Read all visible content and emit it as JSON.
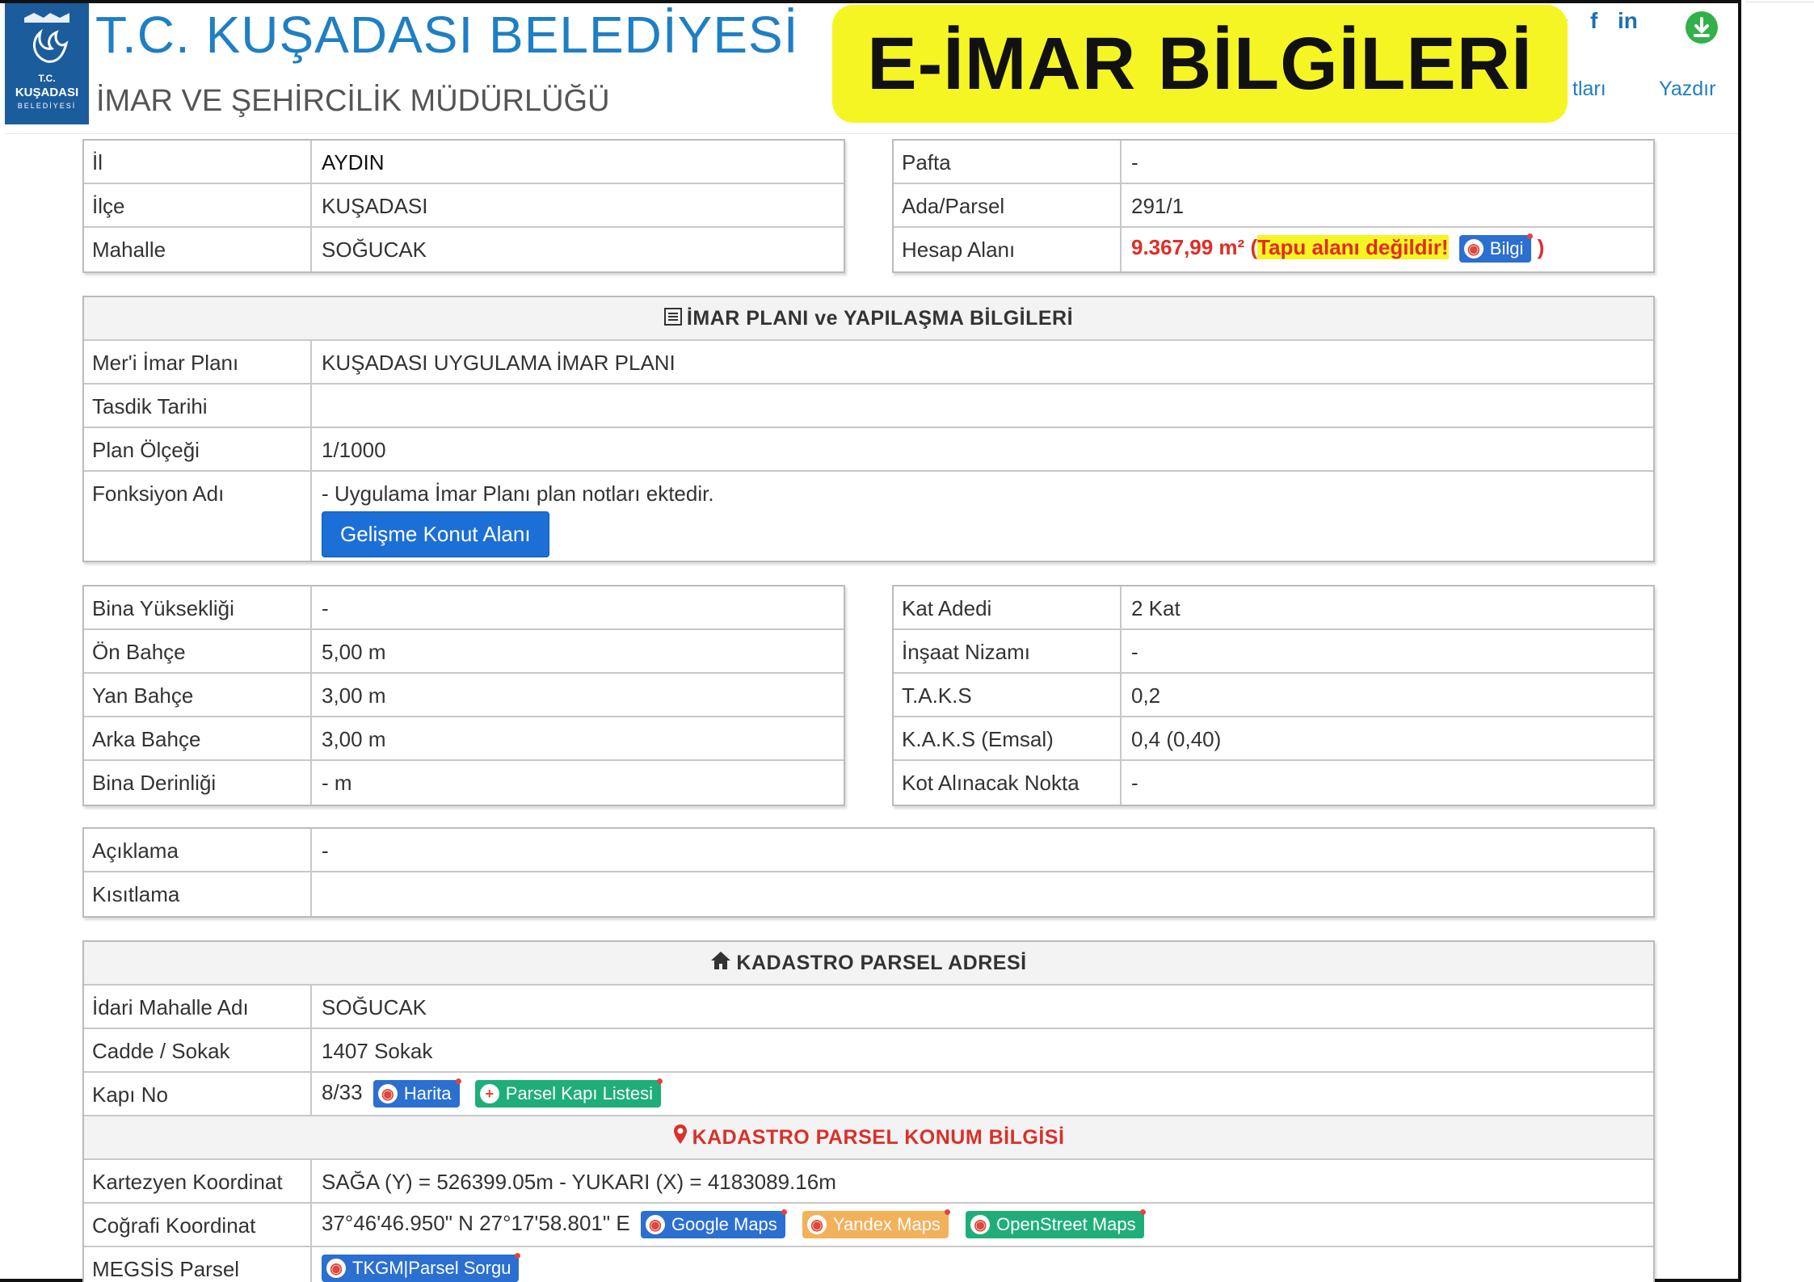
{
  "header": {
    "title": "T.C. KUŞADASI BELEDİYESİ",
    "subtitle": "İMAR VE ŞEHİRCİLİK MÜDÜRLÜĞÜ",
    "logo": {
      "line1": "T.C.",
      "line2": "KUŞADASI",
      "line3": "BELEDİYESİ"
    },
    "banner": "E-İMAR BİLGİLERİ",
    "link_notes": "tları",
    "link_print": "Yazdır",
    "social": {
      "facebook": "f",
      "linkedin": "in"
    }
  },
  "location": {
    "rows": [
      {
        "label": "İl",
        "value": "AYDIN"
      },
      {
        "label": "İlçe",
        "value": "KUŞADASI"
      },
      {
        "label": "Mahalle",
        "value": "SOĞUCAK"
      }
    ]
  },
  "parcel": {
    "pafta_label": "Pafta",
    "pafta_value": "-",
    "ada_label": "Ada/Parsel",
    "ada_value": "291/1",
    "area_label": "Hesap Alanı",
    "area_value": "9.367,99 m²",
    "open_paren": "(",
    "area_warning": "Tapu alanı değildir!",
    "info_button": "Bilgi",
    "close_paren": ")"
  },
  "plan": {
    "header": "İMAR PLANI ve YAPILAŞMA BİLGİLERİ",
    "rows": [
      {
        "label": "Mer'i İmar Planı",
        "value": "KUŞADASI UYGULAMA İMAR PLANI"
      },
      {
        "label": "Tasdik Tarihi",
        "value": ""
      },
      {
        "label": "Plan Ölçeği",
        "value": "1/1000"
      }
    ],
    "function_label": "Fonksiyon Adı",
    "function_note": "- Uygulama İmar Planı plan notları ektedir.",
    "function_button": "Gelişme Konut Alanı"
  },
  "building_left": [
    {
      "label": "Bina Yüksekliği",
      "value": "-"
    },
    {
      "label": "Ön Bahçe",
      "value": "5,00 m"
    },
    {
      "label": "Yan Bahçe",
      "value": "3,00 m"
    },
    {
      "label": "Arka Bahçe",
      "value": "3,00 m"
    },
    {
      "label": "Bina Derinliği",
      "value": "- m"
    }
  ],
  "building_right": [
    {
      "label": "Kat Adedi",
      "value": "2 Kat"
    },
    {
      "label": "İnşaat Nizamı",
      "value": "-"
    },
    {
      "label": "T.A.K.S",
      "value": "0,2"
    },
    {
      "label": "K.A.K.S (Emsal)",
      "value": "0,4 (0,40)"
    },
    {
      "label": "Kot Alınacak Nokta",
      "value": "-"
    }
  ],
  "notes": [
    {
      "label": "Açıklama",
      "value": "-"
    },
    {
      "label": "Kısıtlama",
      "value": ""
    }
  ],
  "address": {
    "header": "KADASTRO PARSEL ADRESİ",
    "mahalle_label": "İdari Mahalle Adı",
    "mahalle_value": "SOĞUCAK",
    "street_label": "Cadde / Sokak",
    "street_value": "1407 Sokak",
    "door_label": "Kapı No",
    "door_value": "8/33",
    "map_button": "Harita",
    "door_list_button": "Parsel Kapı Listesi"
  },
  "position": {
    "header": "KADASTRO PARSEL KONUM BİLGİSİ",
    "cart_label": "Kartezyen Koordinat",
    "cart_value": "SAĞA (Y) = 526399.05m - YUKARI (X) = 4183089.16m",
    "geo_label": "Coğrafi Koordinat",
    "geo_value": "37°46'46.950\" N 27°17'58.801\" E",
    "google": "Google Maps",
    "yandex": "Yandex Maps",
    "osm": "OpenStreet Maps",
    "megsis_label": "MEGSİS Parsel",
    "tkgm": "TKGM|Parsel Sorgu"
  },
  "colors": {
    "accent": "#1e7fc4",
    "banner": "#f5f524",
    "warning": "#e12c25",
    "button": "#1b6fd6"
  }
}
